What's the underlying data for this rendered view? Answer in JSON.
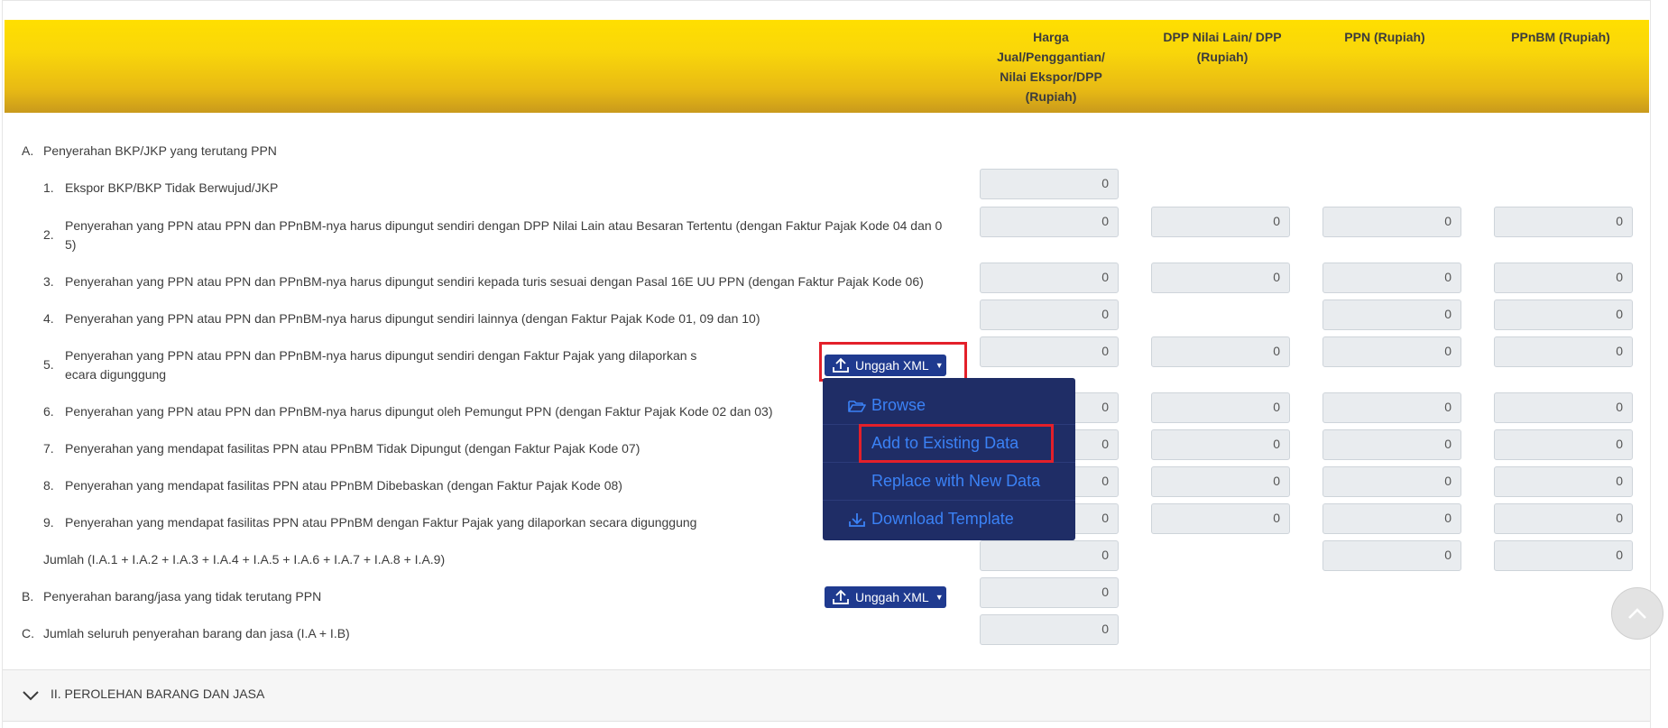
{
  "columns": {
    "harga": [
      "Harga",
      "Jual/Penggantian/",
      "Nilai Ekspor/DPP",
      "(Rupiah)"
    ],
    "dpp": [
      "DPP Nilai Lain/ DPP",
      "(Rupiah)"
    ],
    "ppn": [
      "PPN (Rupiah)"
    ],
    "ppnbm": [
      "PPnBM (Rupiah)"
    ]
  },
  "section_a": {
    "num": "A.",
    "label": "Penyerahan BKP/JKP yang terutang PPN"
  },
  "rows": [
    {
      "num": "1.",
      "lines": [
        "Ekspor BKP/BKP Tidak Berwujud/JKP"
      ],
      "values": {
        "harga": "0"
      }
    },
    {
      "num": "2.",
      "lines": [
        "Penyerahan yang PPN atau PPN dan PPnBM-nya harus dipungut sendiri dengan DPP Nilai Lain atau Besaran Tertentu (dengan Faktur Pajak Kode 04 dan 0",
        "5)"
      ],
      "values": {
        "harga": "0",
        "dpp": "0",
        "ppn": "0",
        "ppnbm": "0"
      }
    },
    {
      "num": "3.",
      "lines": [
        "Penyerahan yang PPN atau PPN dan PPnBM-nya harus dipungut sendiri kepada turis sesuai dengan Pasal 16E UU PPN (dengan Faktur Pajak Kode 06)"
      ],
      "values": {
        "harga": "0",
        "dpp": "0",
        "ppn": "0",
        "ppnbm": "0"
      }
    },
    {
      "num": "4.",
      "lines": [
        "Penyerahan yang PPN atau PPN dan PPnBM-nya harus dipungut sendiri lainnya (dengan Faktur Pajak Kode 01, 09 dan 10)"
      ],
      "values": {
        "harga": "0",
        "ppn": "0",
        "ppnbm": "0"
      }
    },
    {
      "num": "5.",
      "lines": [
        "Penyerahan yang PPN atau PPN dan PPnBM-nya harus dipungut sendiri dengan Faktur Pajak yang dilaporkan s",
        "ecara digunggung"
      ],
      "values": {
        "harga": "0",
        "dpp": "0",
        "ppn": "0",
        "ppnbm": "0"
      }
    },
    {
      "num": "6.",
      "lines": [
        "Penyerahan yang PPN atau PPN dan PPnBM-nya harus dipungut oleh Pemungut PPN (dengan Faktur Pajak Kode 02 dan 03)"
      ],
      "values": {
        "harga": "0",
        "dpp": "0",
        "ppn": "0",
        "ppnbm": "0"
      }
    },
    {
      "num": "7.",
      "lines": [
        "Penyerahan yang mendapat fasilitas PPN atau PPnBM Tidak Dipungut (dengan Faktur Pajak Kode 07)"
      ],
      "values": {
        "harga": "0",
        "dpp": "0",
        "ppn": "0",
        "ppnbm": "0"
      }
    },
    {
      "num": "8.",
      "lines": [
        "Penyerahan yang mendapat fasilitas PPN atau PPnBM Dibebaskan (dengan Faktur Pajak Kode 08)"
      ],
      "values": {
        "harga": "0",
        "dpp": "0",
        "ppn": "0",
        "ppnbm": "0"
      }
    },
    {
      "num": "9.",
      "lines": [
        "Penyerahan yang mendapat fasilitas PPN atau PPnBM dengan Faktur Pajak yang dilaporkan secara digunggung"
      ],
      "values": {
        "harga": "0",
        "dpp": "0",
        "ppn": "0",
        "ppnbm": "0"
      }
    }
  ],
  "jumlah": {
    "label": "Jumlah (I.A.1 + I.A.2 + I.A.3 + I.A.4 + I.A.5 + I.A.6 + I.A.7 + I.A.8 + I.A.9)",
    "values": {
      "harga": "0",
      "ppn": "0",
      "ppnbm": "0"
    }
  },
  "section_b": {
    "num": "B.",
    "label": "Penyerahan barang/jasa yang tidak terutang PPN",
    "value": "0"
  },
  "section_c": {
    "num": "C.",
    "label": "Jumlah seluruh penyerahan barang dan jasa (I.A + I.B)",
    "value": "0"
  },
  "upload_button": {
    "label": "Unggah XML",
    "icon": "upload-icon"
  },
  "dropdown_menu": {
    "items": [
      {
        "label": "Browse",
        "icon": "folder-open-icon"
      },
      {
        "label": "Add to Existing Data",
        "icon": ""
      },
      {
        "label": "Replace with New Data",
        "icon": ""
      },
      {
        "label": "Download Template",
        "icon": "download-icon"
      }
    ]
  },
  "section_ii": {
    "title": "II. PEROLEHAN BARANG DAN JASA"
  },
  "colors": {
    "header_gradient_top": "#ffdf00",
    "header_gradient_bottom": "#c99a1c",
    "button_bg": "#1f3a8f",
    "dropdown_bg": "#1f2d66",
    "dropdown_text": "#3b82f6",
    "highlight_border": "#e3202a",
    "field_bg": "#e9ecef"
  }
}
